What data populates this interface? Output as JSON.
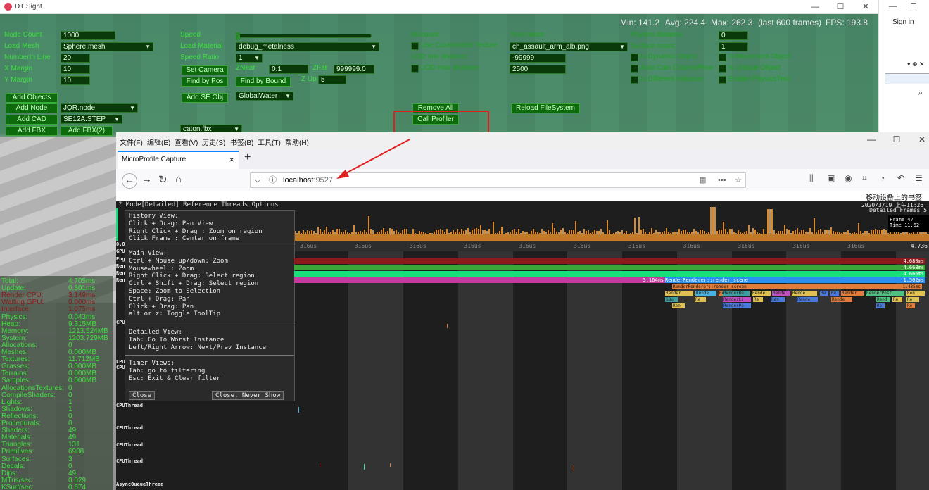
{
  "dt_window": {
    "title": "DT Sight",
    "stats_header": {
      "min": "Min: 141.2",
      "avg": "Avg: 224.4",
      "max": "Max: 262.3",
      "frames": "(last 600 frames)",
      "fps": "FPS: 193.8"
    },
    "col1": {
      "node_count_label": "Node Count",
      "node_count_value": "1000",
      "load_mesh_label": "Load Mesh",
      "load_mesh_value": "Sphere.mesh",
      "number_in_line_label": "NumberIn Line",
      "number_in_line_value": "20",
      "x_margin_label": "X Margin",
      "x_margin_value": "10",
      "y_margin_label": "Y Margin",
      "y_margin_value": "10",
      "add_objects": "Add Objects",
      "add_node": "Add Node",
      "add_node_value": "JQR.node",
      "add_cad": "Add CAD",
      "add_cad_value": "SE12A.STEP",
      "add_fbx": "Add FBX",
      "add_fbx2": "Add FBX(2)"
    },
    "col2": {
      "speed_label": "Speed",
      "load_material_label": "Load Material",
      "load_material_value": "debug_metalness",
      "speed_ratio_label": "Speed Ratio",
      "speed_ratio_value": "1",
      "set_camera": "Set Camera",
      "znear_label": "ZNear",
      "znear_value": "0.1",
      "zfar_label": "ZFar",
      "zfar_value": "999999.0",
      "find_by_pos": "Find by Pos",
      "find_by_bound": "Find by Bound",
      "zup_label": "Z Up",
      "zup_value": "5",
      "add_se_obj": "Add SE Obj",
      "global_water": "GlobalWater",
      "caton_value": "caton.fbx"
    },
    "col3": {
      "all_count": "All count:",
      "use_custom_texture": "Use Customized Texture",
      "lod_min": "LOD min distance:",
      "lod_max": "LOD max distance",
      "remove_all": "Remove All",
      "call_profiler": "Call Profiler"
    },
    "col4": {
      "time_takes": "Time takes:",
      "texture_value": "ch_assault_arm_alb.png",
      "lod_min_value": "-99999",
      "lod_max_value": "2500",
      "reload_fs": "Reload FileSystem"
    },
    "col5": {
      "physics_distance": "Physics distance",
      "physics_distance_value": "0",
      "surface_count": "Surface count:",
      "surface_count_value": "1",
      "is_dynamic": "Is Dynamic Object",
      "auto_calc": "Auto Calc Column/Row",
      "is_different": "Is Different Instance"
    },
    "col6": {
      "is_movement": "Is Movement Object",
      "is_unique": "Is Unique Object",
      "enable_physics": "Enable PhysicsTest"
    },
    "stats": [
      {
        "k": "Total:",
        "v": "4.705ms",
        "red": false
      },
      {
        "k": "Update:",
        "v": "0.301ms",
        "red": false
      },
      {
        "k": "Render CPU:",
        "v": "3.149ms",
        "red": true
      },
      {
        "k": "Waiting GPU:",
        "v": "0.000ms",
        "red": true
      },
      {
        "k": "Interface:",
        "v": "1.075ms",
        "red": true
      },
      {
        "k": "Physics:",
        "v": "0.043ms",
        "red": false
      },
      {
        "k": "Heap:",
        "v": "9.315MB",
        "red": false
      },
      {
        "k": "Memory:",
        "v": "1213.524MB",
        "red": false
      },
      {
        "k": "System:",
        "v": "1203.729MB",
        "red": false
      },
      {
        "k": "Allocations:",
        "v": "0",
        "red": false
      },
      {
        "k": "Meshes:",
        "v": "0.000MB",
        "red": false
      },
      {
        "k": "Textures:",
        "v": "11.712MB",
        "red": false
      },
      {
        "k": "Grasses:",
        "v": "0.000MB",
        "red": false
      },
      {
        "k": "Terrains:",
        "v": "0.000MB",
        "red": false
      },
      {
        "k": "Samples:",
        "v": "0.000MB",
        "red": false
      },
      {
        "k": "AllocationsTextures:",
        "v": "0",
        "red": false
      },
      {
        "k": "CompileShaders:",
        "v": "0",
        "red": false
      },
      {
        "k": "Lights:",
        "v": "1",
        "red": false
      },
      {
        "k": "Shadows:",
        "v": "1",
        "red": false
      },
      {
        "k": "Reflections:",
        "v": "0",
        "red": false
      },
      {
        "k": "Procedurals:",
        "v": "0",
        "red": false
      },
      {
        "k": "Shaders:",
        "v": "49",
        "red": false
      },
      {
        "k": "Materials:",
        "v": "49",
        "red": false
      },
      {
        "k": "Triangles:",
        "v": "131",
        "red": false
      },
      {
        "k": "Primitives:",
        "v": "6908",
        "red": false
      },
      {
        "k": "Surfaces:",
        "v": "3",
        "red": false
      },
      {
        "k": "Decals:",
        "v": "0",
        "red": false
      },
      {
        "k": "Dips:",
        "v": "49",
        "red": false
      },
      {
        "k": "MTris/sec:",
        "v": "0.029",
        "red": false
      },
      {
        "k": "KSurf/sec:",
        "v": "0.674",
        "red": false
      }
    ]
  },
  "right_window": {
    "signin": "Sign in"
  },
  "browser": {
    "menu": [
      "文件(F)",
      "编辑(E)",
      "查看(V)",
      "历史(S)",
      "书签(B)",
      "工具(T)",
      "帮助(H)"
    ],
    "tab_title": "MicroProfile Capture",
    "url_host": "localhost",
    "url_port": ":9527",
    "mobile_bookmarks": "移动设备上的书签"
  },
  "profiler": {
    "menu": "?  Mode[Detailed]  Reference  Threads  Options",
    "date": "2020/3/19 上午11:26:",
    "detailed_frames": "Detailed Frames 5",
    "frame_label": "Frame",
    "frame_value": "47",
    "time_label": "Time",
    "time_value": "11.62",
    "ruler_label": "316us",
    "ruler_end": "4.736",
    "track_times": [
      "4.680ms",
      "4.668ms",
      "4.666ms",
      "1.502ms"
    ],
    "render_scene_time": "3.164ms",
    "render_scene": "RenderRenderer::render_scene",
    "render_screen": "RenderRenderer::render_screen",
    "render_screen_time": "1.435ms",
    "thread_left_labels": [
      "0.0",
      "GPU",
      "Eng",
      "Ren",
      "Ren",
      "Ren"
    ],
    "cpu_thread": "CPUThread",
    "cpu_threads_short": [
      "CPU",
      "CPU",
      "CPU"
    ],
    "async_thread": "AsyncQueueThread",
    "blocks": [
      "Render",
      "Rende",
      "Re",
      "RenderRe",
      "Rende",
      "Rende",
      "Rende",
      "Re",
      "Re",
      "Render",
      "RenderPost",
      "Ren"
    ],
    "blocks2": [
      "GBu",
      "Re",
      "RenderLi",
      "Re",
      "Ren",
      "Rende",
      "Rende",
      "Rend",
      "Re",
      "Re"
    ],
    "blocks3": [
      "Ren",
      "RenderPo",
      "Re",
      "Re"
    ]
  },
  "help": {
    "history": "History View:\nClick + Drag: Pan View\nRight Click + Drag : Zoom on region\nClick Frame : Center on frame",
    "main": "Main View:\nCtrl + Mouse up/down: Zoom\nMousewheel : Zoom\nRight Click + Drag: Select region\nCtrl + Shift + Drag: Select region\nSpace: Zoom to Selection\nCtrl + Drag: Pan\nClick + Drag: Pan\nalt or z: Toggle ToolTip",
    "detailed": "Detailed View:\nTab: Go To Worst Instance\nLeft/Right Arrow: Next/Prev Instance",
    "timer": "Timer Views:\nTab: go to filtering\nEsc: Exit & Clear filter",
    "close": "Close",
    "close_never": "Close, Never Show"
  }
}
